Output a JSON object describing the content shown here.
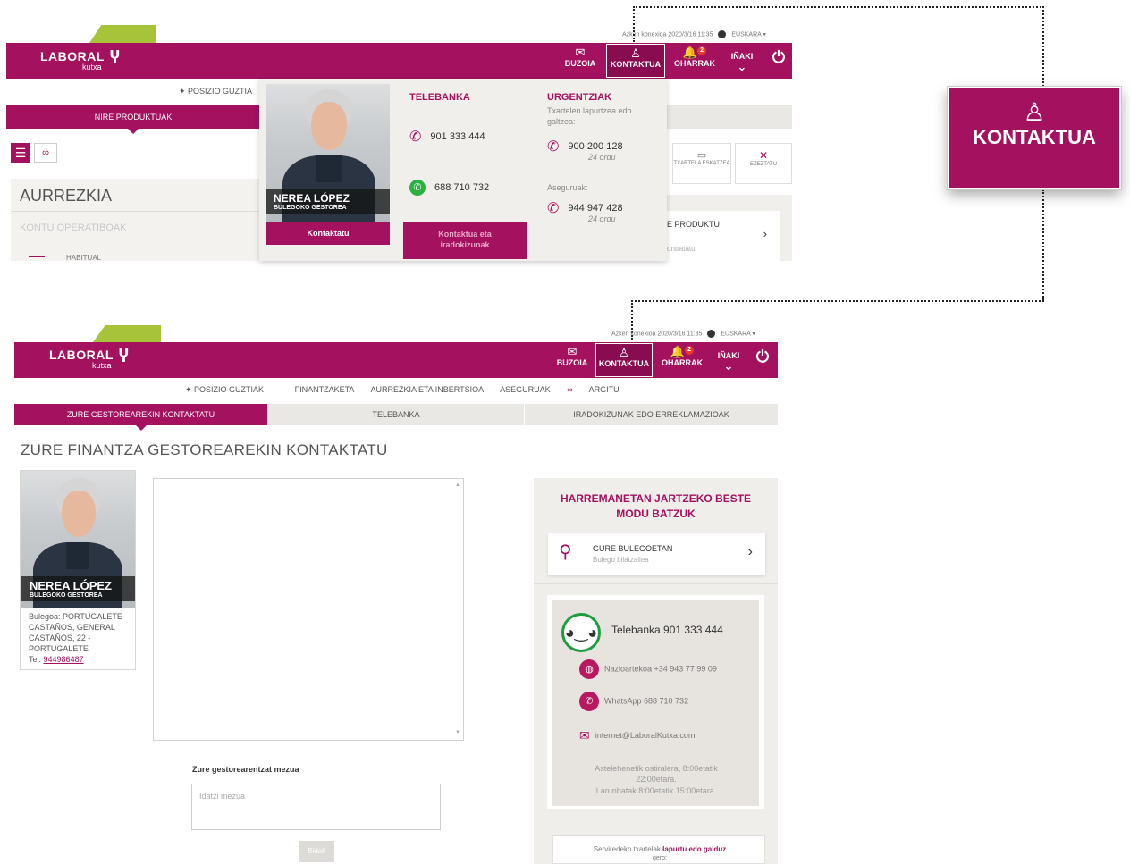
{
  "top_screen": {
    "last_connection": "Azken konexioa 2020/3/16 11:35",
    "language": "EUSKARA",
    "logo": "LABORAL",
    "logo_sub": "kutxa",
    "header_buttons": [
      {
        "label": "BUZOIA",
        "icon": "mail-icon"
      },
      {
        "label": "KONTAKTUA",
        "icon": "contact-icon"
      },
      {
        "label": "OHARRAK",
        "icon": "bell-icon",
        "badge": "2"
      },
      {
        "label": "IÑAKI",
        "icon": "chevron-down-icon"
      }
    ],
    "nav_item": "POSIZIO GUZTIA",
    "tab_active": "NIRE PRODUKTUAK",
    "section": "AURREZKIA",
    "subsection": "KONTU OPERATIBOAK",
    "row_partial": "HABITUAL",
    "side_actions": [
      "TXARTELA ESKATZEA",
      "EZEZTATU"
    ],
    "side_card_title": "E PRODUKTU",
    "side_card_sub": "ontratatu",
    "dropdown": {
      "manager_name": "NEREA LÓPEZ",
      "manager_role": "BULEGOKO GESTOREA",
      "contact_button": "Kontaktatu",
      "telebanka_title": "TELEBANKA",
      "telebanka_phone": "901 333 444",
      "whatsapp_phone": "688 710 732",
      "claims_button": "Kontaktua eta iradokizunak",
      "urgent_title": "URGENTZIAK",
      "urgent_desc": "Txartelen lapurtzea edo galtzea:",
      "urgent_phone": "900 200 128",
      "urgent_hours": "24 ordu",
      "insurance_label": "Aseguruak:",
      "insurance_phone": "944 947 428",
      "insurance_hours": "24 ordu"
    }
  },
  "zoom_label": "KONTAKTUA",
  "bottom_screen": {
    "last_connection": "Azken konexioa 2020/3/16 11:35",
    "language": "EUSKARA",
    "logo": "LABORAL",
    "logo_sub": "kutxa",
    "header_buttons": [
      {
        "label": "BUZOIA"
      },
      {
        "label": "KONTAKTUA"
      },
      {
        "label": "OHARRAK",
        "badge": "2"
      },
      {
        "label": "IÑAKI"
      }
    ],
    "nav": [
      "POSIZIO GUZTIAK",
      "FINANTZAKETA",
      "AURREZKIA ETA INBERTSIOA",
      "ASEGURUAK",
      "ARGITU"
    ],
    "tabs": [
      "ZURE GESTOREAREKIN KONTAKTATU",
      "TELEBANKA",
      "IRADOKIZUNAK EDO ERREKLAMAZIOAK"
    ],
    "page_title": "ZURE FINANTZA GESTOREAREKIN KONTAKTATU",
    "manager_name": "NEREA LÓPEZ",
    "manager_role": "BULEGOKO GESTOREA",
    "address_lines": [
      "Bulegoa: PORTUGALETE-",
      "CASTAÑOS, GENERAL",
      "CASTAÑOS, 22 -",
      "PORTUGALETE"
    ],
    "tel_label": "Tel:",
    "tel_number": "944986487",
    "message_label": "Zure gestorearentzat mezua",
    "message_placeholder": "Idatzi mezua",
    "send_button": "Bidali",
    "side_title": "HARREMANETAN JARTZEKO BESTE MODU BATZUK",
    "office_title": "GURE BULEGOETAN",
    "office_sub": "Bulego bilatzailea",
    "telebanka_title": "Telebanka 901 333 444",
    "international": "Nazioartekoa +34 943 77 99 09",
    "whatsapp": "WhatsApp 688 710 732",
    "email": "internet@LaboralKutxa.com",
    "hours_1": "Astelehenetik ostiralera, 8:00etatik 22:00etara.",
    "hours_2": "Larunbatak 8:00etatik 15:00etara.",
    "bottom_note_a": "Serviredeko txartelak",
    "bottom_note_b": "lapurtu edo galduz",
    "bottom_note_c": "gero:"
  },
  "colors": {
    "brand": "#a3115f",
    "accent_green": "#a6c33a",
    "panel_bg": "#f0eeea"
  }
}
